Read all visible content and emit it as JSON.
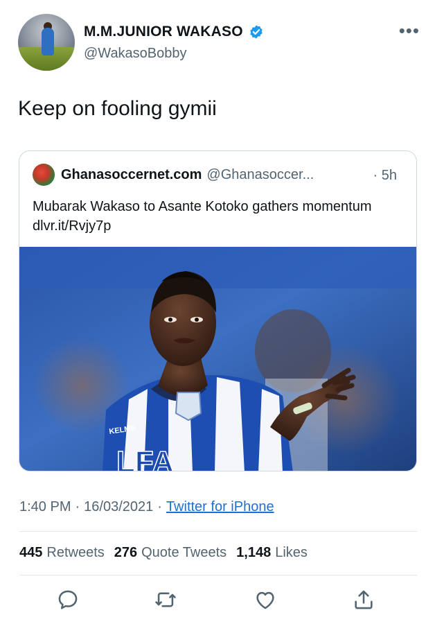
{
  "author": {
    "name": "M.M.JUNIOR WAKASO",
    "handle": "@WakasoBobby",
    "verified_icon": "verified-badge-icon"
  },
  "tweet": {
    "text": "Keep on fooling gymii"
  },
  "quoted": {
    "name": "Ghanasoccernet.com",
    "handle": "@Ghanasoccer...",
    "time": "· 5h",
    "text": "Mubarak Wakaso to Asante Kotoko gathers momentum dlvr.it/Rvjy7p",
    "image_jersey_brand": "KELME",
    "image_jersey_text": "LFA"
  },
  "meta": {
    "time": "1:40 PM",
    "separator": "·",
    "date": "16/03/2021",
    "separator2": "·",
    "source": "Twitter for iPhone"
  },
  "stats": {
    "retweets_count": "445",
    "retweets_label": "Retweets",
    "quotes_count": "276",
    "quotes_label": "Quote Tweets",
    "likes_count": "1,148",
    "likes_label": "Likes"
  },
  "icons": {
    "reply": "reply-icon",
    "retweet": "retweet-icon",
    "like": "heart-icon",
    "share": "share-icon",
    "more": "more-icon"
  },
  "colors": {
    "verified": "#1d9bf0",
    "link": "#1d6fd8",
    "secondary_text": "#536471"
  }
}
